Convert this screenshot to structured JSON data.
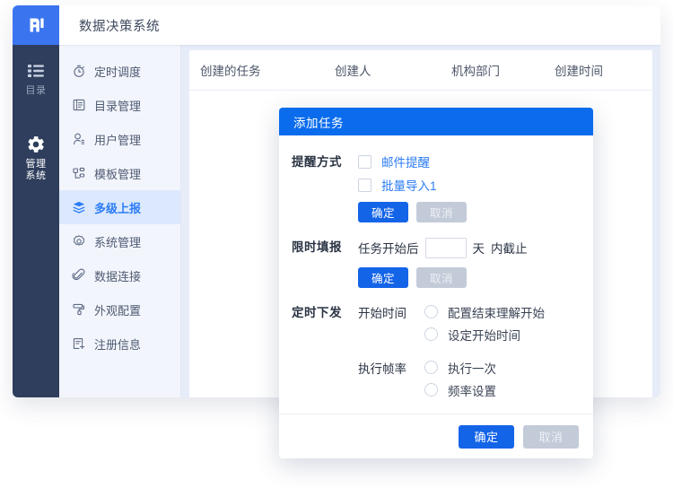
{
  "header": {
    "title": "数据决策系统",
    "logo_icon": "finereport-logo-icon"
  },
  "rail": {
    "items": [
      {
        "label": "目录",
        "icon": "list-icon",
        "active": false
      },
      {
        "label": "管理\n系统",
        "label_line1": "管理",
        "label_line2": "系统",
        "icon": "gear-icon",
        "active": true
      }
    ]
  },
  "sidebar": {
    "items": [
      {
        "label": "定时调度",
        "icon": "stopwatch-icon"
      },
      {
        "label": "目录管理",
        "icon": "catalog-icon"
      },
      {
        "label": "用户管理",
        "icon": "user-icon"
      },
      {
        "label": "模板管理",
        "icon": "template-icon"
      },
      {
        "label": "多级上报",
        "icon": "layers-icon"
      },
      {
        "label": "系统管理",
        "icon": "settings-icon"
      },
      {
        "label": "数据连接",
        "icon": "link-icon"
      },
      {
        "label": "外观配置",
        "icon": "paint-roller-icon"
      },
      {
        "label": "注册信息",
        "icon": "register-icon"
      }
    ],
    "active_index": 4
  },
  "table": {
    "columns": [
      "创建的任务",
      "创建人",
      "机构部门",
      "创建时间"
    ]
  },
  "modal": {
    "title": "添加任务",
    "remind": {
      "label": "提醒方式",
      "options": [
        {
          "label": "邮件提醒",
          "checked": false
        },
        {
          "label": "批量导入1",
          "checked": false
        }
      ],
      "confirm_label": "确定",
      "cancel_label": "取消"
    },
    "deadline": {
      "label": "限时填报",
      "prefix_text": "任务开始后",
      "input_value": "",
      "input_placeholder": "",
      "unit_text": "天",
      "suffix_text": "内截止",
      "confirm_label": "确定",
      "cancel_label": "取消"
    },
    "schedule": {
      "label": "定时下发",
      "start_time": {
        "label": "开始时间",
        "options": [
          {
            "label": "配置结束理解开始",
            "selected": false
          },
          {
            "label": "设定开始时间",
            "selected": false
          }
        ]
      },
      "frequency": {
        "label": "执行帧率",
        "options": [
          {
            "label": "执行一次",
            "selected": false
          },
          {
            "label": "频率设置",
            "selected": false
          }
        ]
      }
    },
    "footer": {
      "confirm_label": "确定",
      "cancel_label": "取消"
    }
  },
  "colors": {
    "brand_blue": "#3b74ef",
    "modal_blue": "#0a6ced",
    "primary_button": "#1464e8",
    "rail_dark": "#2e3e5c",
    "menu_bg": "#f3f5fc",
    "menu_active_bg": "#dbe8fd",
    "accent_text": "#2c7cf5"
  }
}
